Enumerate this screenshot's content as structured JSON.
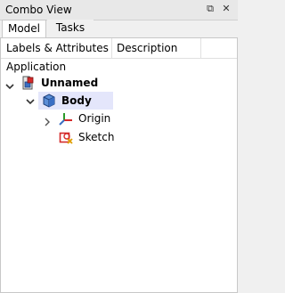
{
  "window": {
    "title": "Combo View",
    "float_glyph": "⧉",
    "close_glyph": "✕"
  },
  "tabs": [
    {
      "label": "Model",
      "active": true
    },
    {
      "label": "Tasks",
      "active": false
    }
  ],
  "tree": {
    "columns": [
      "Labels & Attributes",
      "Description"
    ],
    "section_label": "Application",
    "items": [
      {
        "label": "Unnamed",
        "bold": true,
        "expanded": true,
        "icon": "document-icon"
      },
      {
        "label": "Body",
        "bold": true,
        "expanded": true,
        "selected": true,
        "icon": "body-icon"
      },
      {
        "label": "Origin",
        "bold": false,
        "expanded": false,
        "icon": "origin-icon"
      },
      {
        "label": "Sketch",
        "bold": false,
        "icon": "sketch-icon"
      }
    ]
  },
  "colors": {
    "selection": "#e4e6fb",
    "body_icon": "#3a6fc4",
    "sketch_icon": "#d42a2a"
  }
}
